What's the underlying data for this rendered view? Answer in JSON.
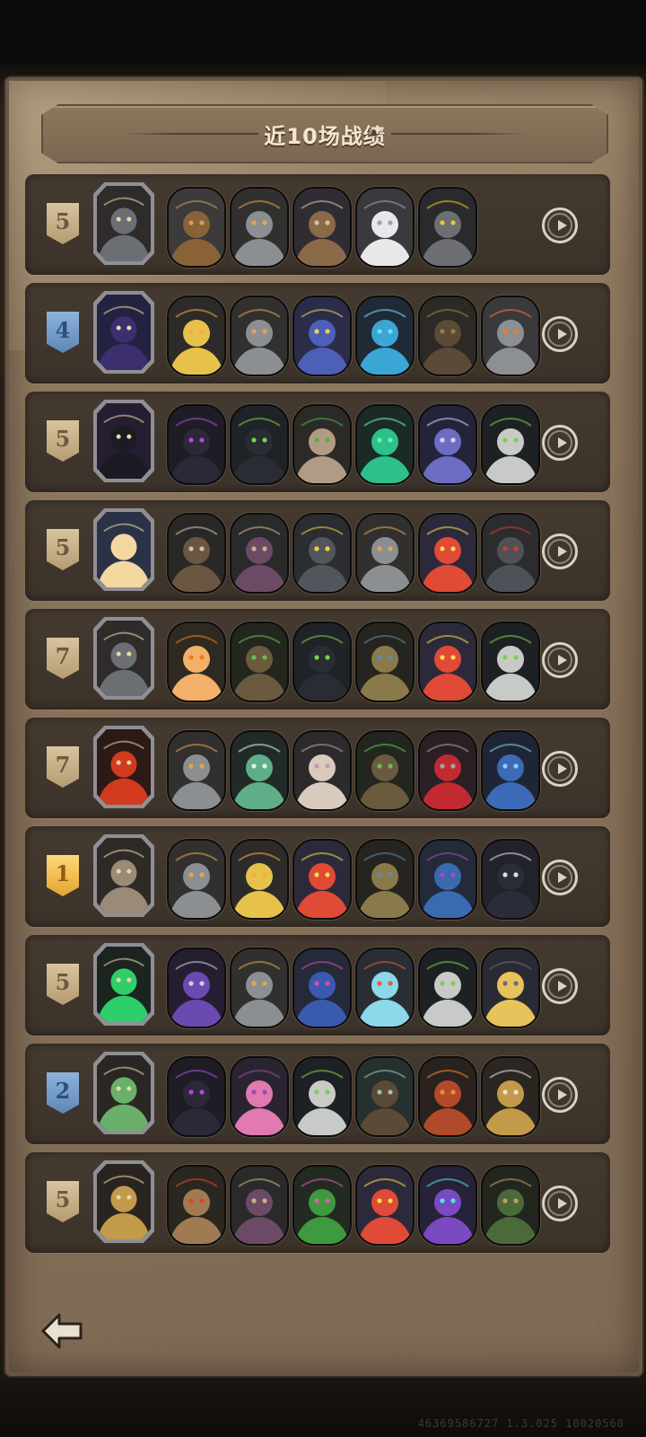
{
  "title": "近10场战绩",
  "version_text": "46369586727 1.3.025 10020560",
  "matches": [
    {
      "rank": "5",
      "rank_tier": "tan",
      "hero": {
        "name": "rat-hero",
        "bg": "#2e2b2a",
        "fg": "#6b6e72"
      },
      "units": [
        {
          "name": "ruined-tank",
          "bg": "#3c3a3a",
          "fg": "#8a6238",
          "accent": "#c9a060"
        },
        {
          "name": "cannon-bot",
          "bg": "#32302f",
          "fg": "#8c8f92",
          "accent": "#e4a44a"
        },
        {
          "name": "desert-bandit",
          "bg": "#2f2d33",
          "fg": "#8b6a4a",
          "accent": "#d9c2a0"
        },
        {
          "name": "white-cannon",
          "bg": "#3a3a3e",
          "fg": "#e8e8ea",
          "accent": "#9aa2ae"
        },
        {
          "name": "lightning-turret",
          "bg": "#2a2a2c",
          "fg": "#6d6f72",
          "accent": "#f2c531"
        }
      ]
    },
    {
      "rank": "4",
      "rank_tier": "blue",
      "hero": {
        "name": "bat-witch-hero",
        "bg": "#232240",
        "fg": "#3d2f6e"
      },
      "units": [
        {
          "name": "cheese-bot",
          "bg": "#2d2b2a",
          "fg": "#e7c24a",
          "accent": "#f6ad3d"
        },
        {
          "name": "cannon-bot",
          "bg": "#32302f",
          "fg": "#8c8f92",
          "accent": "#e4a44a"
        },
        {
          "name": "blue-dragon",
          "bg": "#2a2c4a",
          "fg": "#4e5fb8",
          "accent": "#e9d25a"
        },
        {
          "name": "ice-sprite",
          "bg": "#1f2a36",
          "fg": "#3aa6d6",
          "accent": "#6fe0f2"
        },
        {
          "name": "wooden-totem",
          "bg": "#2c2a26",
          "fg": "#5a4a36",
          "accent": "#9a7d4a"
        },
        {
          "name": "heart-robot",
          "bg": "#3a3a3c",
          "fg": "#8c9094",
          "accent": "#f27a2a"
        }
      ]
    },
    {
      "rank": "5",
      "rank_tier": "tan",
      "hero": {
        "name": "shadow-mage-hero",
        "bg": "#251d30",
        "fg": "#1c1a22"
      },
      "units": [
        {
          "name": "dark-lord",
          "bg": "#1e1d26",
          "fg": "#2b2838",
          "accent": "#b04ad6"
        },
        {
          "name": "hooded-reaper",
          "bg": "#1f2226",
          "fg": "#2a2c33",
          "accent": "#7bd14a"
        },
        {
          "name": "old-woman",
          "bg": "#2c2a26",
          "fg": "#b29b84",
          "accent": "#4fb04a"
        },
        {
          "name": "green-spirit",
          "bg": "#1c2a26",
          "fg": "#2ec08a",
          "accent": "#6ff2b0"
        },
        {
          "name": "blue-witch",
          "bg": "#23243a",
          "fg": "#6c6cc2",
          "accent": "#ddd0f0"
        },
        {
          "name": "skeleton-scythe",
          "bg": "#1d2124",
          "fg": "#c8cac8",
          "accent": "#7bd14a"
        }
      ]
    },
    {
      "rank": "5",
      "rank_tier": "tan",
      "hero": {
        "name": "alice-hero",
        "bg": "#2b3248",
        "fg": "#f3d8a0"
      },
      "units": [
        {
          "name": "axe-warrior",
          "bg": "#2a2826",
          "fg": "#6b5642",
          "accent": "#c9c2b8"
        },
        {
          "name": "mushroom-beast",
          "bg": "#2a2a2a",
          "fg": "#6c4a66",
          "accent": "#c6b48a"
        },
        {
          "name": "iron-furnace",
          "bg": "#2b2d30",
          "fg": "#51565c",
          "accent": "#f2d23a"
        },
        {
          "name": "cannon-bot",
          "bg": "#32302f",
          "fg": "#8c8f92",
          "accent": "#e4a44a"
        },
        {
          "name": "tomato-man",
          "bg": "#2c2a3a",
          "fg": "#e04a36",
          "accent": "#f2e04a"
        },
        {
          "name": "armored-knight",
          "bg": "#2c2c2e",
          "fg": "#4e5258",
          "accent": "#d93a2a"
        }
      ]
    },
    {
      "rank": "7",
      "rank_tier": "tan",
      "hero": {
        "name": "rat-hero",
        "bg": "#2e2b2a",
        "fg": "#6b6e72"
      },
      "units": [
        {
          "name": "pumpkin-girl",
          "bg": "#2e2a22",
          "fg": "#f2b068",
          "accent": "#f27a1a"
        },
        {
          "name": "tree-ent",
          "bg": "#22261e",
          "fg": "#6a5a3e",
          "accent": "#62c24a"
        },
        {
          "name": "hooded-reaper",
          "bg": "#1f2226",
          "fg": "#2a2c33",
          "accent": "#7bd14a"
        },
        {
          "name": "straw-hat-farmer",
          "bg": "#26241e",
          "fg": "#8a7a4a",
          "accent": "#5c8ab0"
        },
        {
          "name": "tomato-man",
          "bg": "#2c2a3a",
          "fg": "#e04a36",
          "accent": "#f2e04a"
        },
        {
          "name": "skeleton-scythe",
          "bg": "#1d2124",
          "fg": "#c8cac8",
          "accent": "#7bd14a"
        }
      ]
    },
    {
      "rank": "7",
      "rank_tier": "tan",
      "hero": {
        "name": "fire-demon-hero",
        "bg": "#2b1a16",
        "fg": "#d23a1e"
      },
      "units": [
        {
          "name": "cannon-bot",
          "bg": "#32302f",
          "fg": "#8c8f92",
          "accent": "#e4a44a"
        },
        {
          "name": "green-goblin",
          "bg": "#222a28",
          "fg": "#5fae8a",
          "accent": "#e4f0ea"
        },
        {
          "name": "mouse-pot",
          "bg": "#2c2a2a",
          "fg": "#d8cbbd",
          "accent": "#c29ab8"
        },
        {
          "name": "tree-ent",
          "bg": "#22261e",
          "fg": "#6a5a3e",
          "accent": "#62c24a"
        },
        {
          "name": "vampire-lady",
          "bg": "#2a2024",
          "fg": "#c22a32",
          "accent": "#9aa6b0"
        },
        {
          "name": "blue-flower-beast",
          "bg": "#1e2636",
          "fg": "#3c6ab8",
          "accent": "#8ad0f2"
        }
      ]
    },
    {
      "rank": "1",
      "rank_tier": "gold",
      "hero": {
        "name": "deer-lord-hero",
        "bg": "#2e2a26",
        "fg": "#9a8a76"
      },
      "units": [
        {
          "name": "cannon-bot",
          "bg": "#32302f",
          "fg": "#8c8f92",
          "accent": "#e4a44a"
        },
        {
          "name": "cheese-bot",
          "bg": "#2d2b2a",
          "fg": "#e7c24a",
          "accent": "#f6ad3d"
        },
        {
          "name": "tomato-man",
          "bg": "#2c2a3a",
          "fg": "#e04a36",
          "accent": "#f2e04a"
        },
        {
          "name": "straw-hat-farmer",
          "bg": "#26241e",
          "fg": "#8a7a4a",
          "accent": "#5c8ab0"
        },
        {
          "name": "elf-sorceress",
          "bg": "#232a3a",
          "fg": "#3a6ab0",
          "accent": "#b14ab0"
        },
        {
          "name": "top-hat-gentleman",
          "bg": "#22232a",
          "fg": "#2a2c38",
          "accent": "#e0e0e4"
        }
      ]
    },
    {
      "rank": "5",
      "rank_tier": "tan",
      "hero": {
        "name": "corrupted-tree-hero",
        "bg": "#1c2420",
        "fg": "#2ecf6a"
      },
      "units": [
        {
          "name": "purple-reaper",
          "bg": "#241e30",
          "fg": "#6a4ab0",
          "accent": "#d0cde0"
        },
        {
          "name": "cannon-bot",
          "bg": "#32302f",
          "fg": "#8c8f92",
          "accent": "#e4a44a"
        },
        {
          "name": "spiked-dragon",
          "bg": "#242a3a",
          "fg": "#3a5ab0",
          "accent": "#d94ab0"
        },
        {
          "name": "fish-bowl-bot",
          "bg": "#2a2e34",
          "fg": "#8ad8e8",
          "accent": "#e85a3a"
        },
        {
          "name": "skeleton-scythe",
          "bg": "#1d2124",
          "fg": "#c8cac8",
          "accent": "#7bd14a"
        },
        {
          "name": "blonde-priest",
          "bg": "#2a2a34",
          "fg": "#e8c25a",
          "accent": "#6a6a82"
        }
      ]
    },
    {
      "rank": "2",
      "rank_tier": "blue",
      "hero": {
        "name": "goblin-witch-hero",
        "bg": "#2a2624",
        "fg": "#6ab06a"
      },
      "units": [
        {
          "name": "dark-lord",
          "bg": "#1e1d26",
          "fg": "#2b2838",
          "accent": "#b04ad6"
        },
        {
          "name": "pink-doll",
          "bg": "#2a2430",
          "fg": "#e07ab0",
          "accent": "#9a4ab0"
        },
        {
          "name": "skeleton-scythe",
          "bg": "#1d2124",
          "fg": "#c8cac8",
          "accent": "#7bd14a"
        },
        {
          "name": "ghost-ship",
          "bg": "#26302e",
          "fg": "#5a4a36",
          "accent": "#9ac2b8"
        },
        {
          "name": "lava-golem",
          "bg": "#2a221e",
          "fg": "#b04a2a",
          "accent": "#f28a2a"
        },
        {
          "name": "clock-monster",
          "bg": "#2a2622",
          "fg": "#c29a4a",
          "accent": "#e8e4da"
        }
      ]
    },
    {
      "rank": "5",
      "rank_tier": "tan",
      "hero": {
        "name": "clock-tower-hero",
        "bg": "#2a2420",
        "fg": "#c29a4a"
      },
      "units": [
        {
          "name": "stone-golem",
          "bg": "#2a2620",
          "fg": "#a07a52",
          "accent": "#d94a2a"
        },
        {
          "name": "mushroom-beast",
          "bg": "#2a2a2a",
          "fg": "#6c4a66",
          "accent": "#c6b48a"
        },
        {
          "name": "cactus-buddy",
          "bg": "#222a22",
          "fg": "#3e9a3e",
          "accent": "#e05ab0"
        },
        {
          "name": "tomato-man",
          "bg": "#2c2a3a",
          "fg": "#e04a36",
          "accent": "#f2e04a"
        },
        {
          "name": "purple-archer",
          "bg": "#26223a",
          "fg": "#7a4ac2",
          "accent": "#5ae0e8"
        },
        {
          "name": "horned-demon",
          "bg": "#22261e",
          "fg": "#4a6a3a",
          "accent": "#c2a05a"
        }
      ]
    }
  ]
}
